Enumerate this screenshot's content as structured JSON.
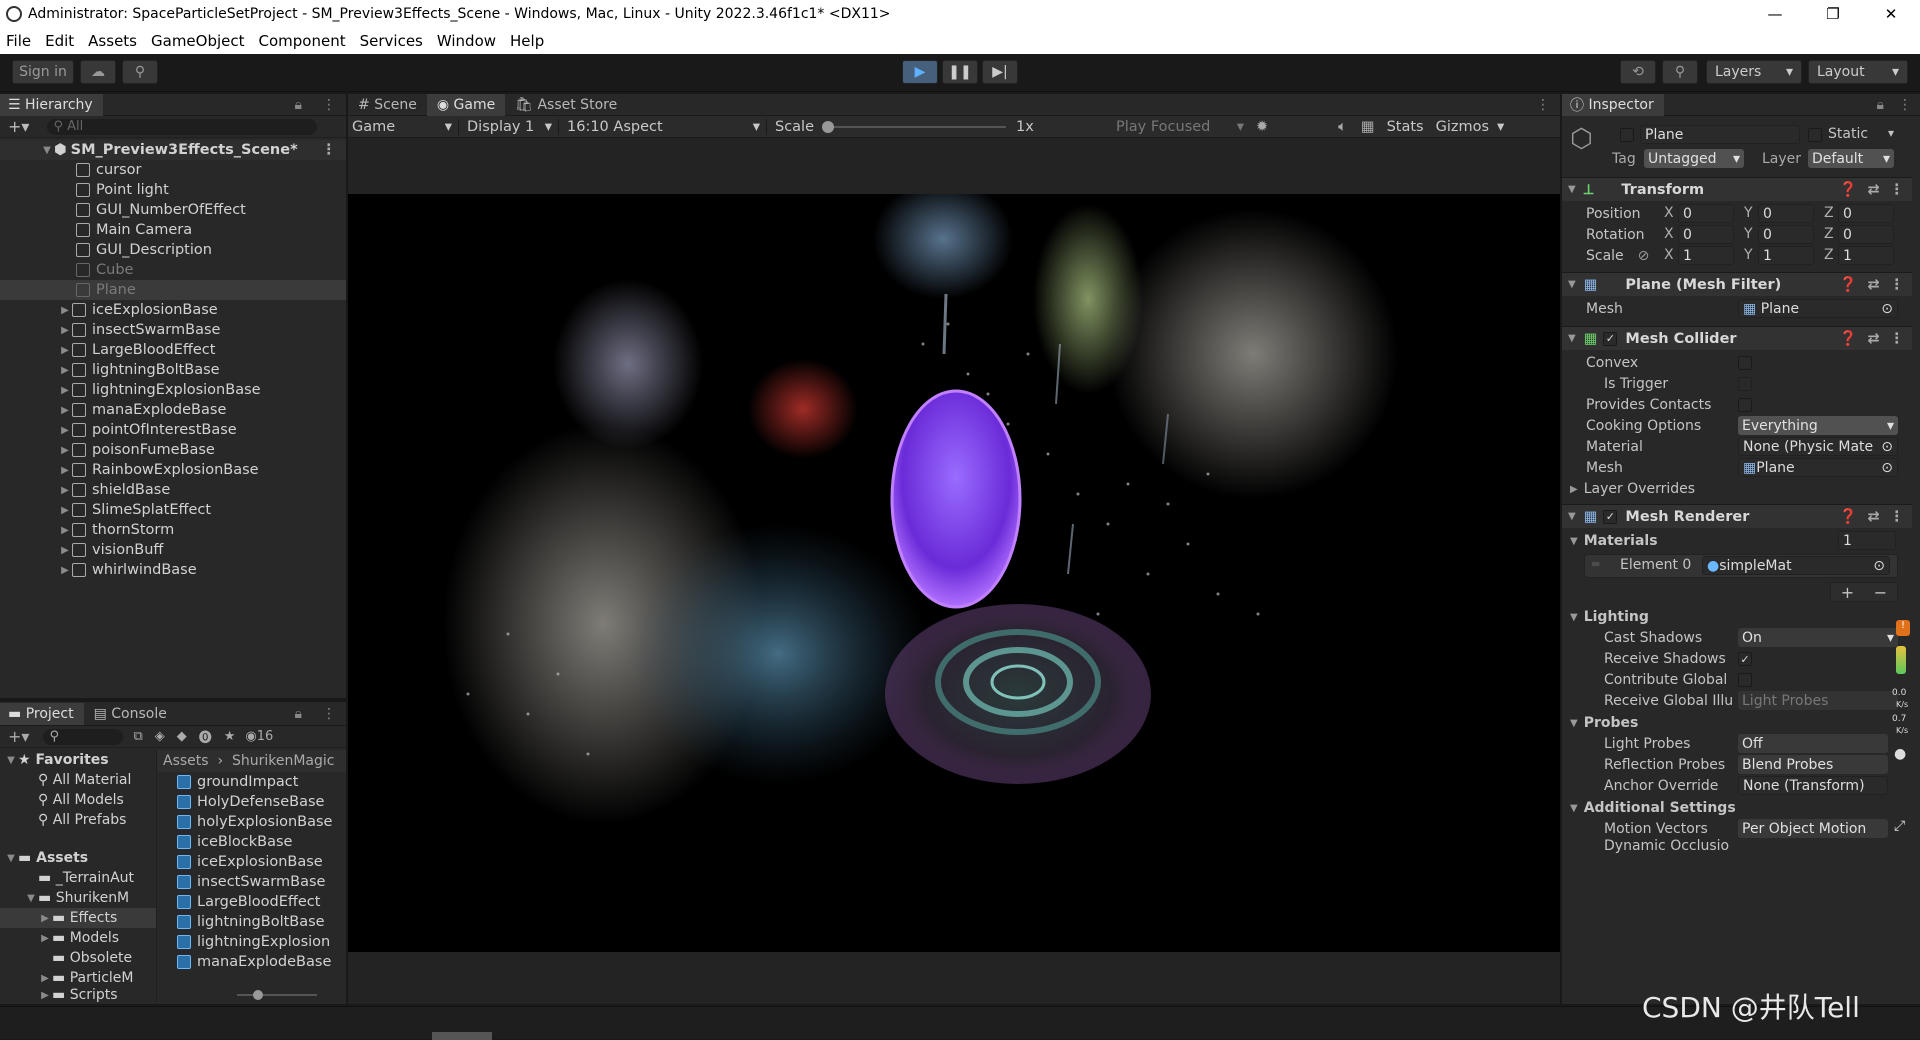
{
  "window": {
    "title": "Administrator: SpaceParticleSetProject - SM_Preview3Effects_Scene - Windows, Mac, Linux - Unity 2022.3.46f1c1* <DX11>"
  },
  "menu": [
    "File",
    "Edit",
    "Assets",
    "GameObject",
    "Component",
    "Services",
    "Window",
    "Help"
  ],
  "toolbar": {
    "sign_in": "Sign in",
    "layers": "Layers",
    "layout": "Layout"
  },
  "hierarchy": {
    "tab": "Hierarchy",
    "search_placeholder": "All",
    "scene": "SM_Preview3Effects_Scene*",
    "items": [
      "cursor",
      "Point light",
      "GUI_NumberOfEffect",
      "Main Camera",
      "GUI_Description",
      "Cube",
      "Plane",
      "iceExplosionBase",
      "insectSwarmBase",
      "LargeBloodEffect",
      "lightningBoltBase",
      "lightningExplosionBase",
      "manaExplodeBase",
      "pointOfInterestBase",
      "poisonFumeBase",
      "RainbowExplosionBase",
      "shieldBase",
      "SlimeSplatEffect",
      "thornStorm",
      "visionBuff",
      "whirlwindBase"
    ]
  },
  "project": {
    "tab_project": "Project",
    "tab_console": "Console",
    "hidden_count": "16",
    "favorites": "Favorites",
    "fav_items": [
      "All Material",
      "All Models",
      "All Prefabs"
    ],
    "assets": "Assets",
    "asset_tree": [
      "_TerrainAut",
      "ShurikenM",
      "Effects",
      "Models",
      "Obsolete",
      "ParticleM",
      "Scripts"
    ],
    "breadcrumb": [
      "Assets",
      "ShurikenMagic"
    ],
    "files": [
      "groundImpact",
      "HolyDefenseBase",
      "holyExplosionBase",
      "iceBlockBase",
      "iceExplosionBase",
      "insectSwarmBase",
      "LargeBloodEffect",
      "lightningBoltBase",
      "lightningExplosion",
      "manaExplodeBase"
    ]
  },
  "game": {
    "tabs": [
      "Scene",
      "Game",
      "Asset Store"
    ],
    "mode": "Game",
    "display": "Display 1",
    "aspect": "16:10 Aspect",
    "scale_label": "Scale",
    "scale_value": "1x",
    "play_focused": "Play Focused",
    "stats": "Stats",
    "gizmos": "Gizmos"
  },
  "inspector": {
    "tab": "Inspector",
    "name": "Plane",
    "static": "Static",
    "tag_label": "Tag",
    "tag": "Untagged",
    "layer_label": "Layer",
    "layer": "Default",
    "transform": {
      "title": "Transform",
      "rows": [
        {
          "label": "Position",
          "x": "0",
          "y": "0",
          "z": "0"
        },
        {
          "label": "Rotation",
          "x": "0",
          "y": "0",
          "z": "0"
        },
        {
          "label": "Scale",
          "x": "1",
          "y": "1",
          "z": "1"
        }
      ]
    },
    "axis": [
      "X",
      "Y",
      "Z"
    ],
    "meshfilter": {
      "title": "Plane (Mesh Filter)",
      "mesh_label": "Mesh",
      "mesh": "Plane"
    },
    "meshcollider": {
      "title": "Mesh Collider",
      "convex": "Convex",
      "is_trigger": "Is Trigger",
      "provides_contacts": "Provides Contacts",
      "cooking_label": "Cooking Options",
      "cooking": "Everything",
      "material_label": "Material",
      "material": "None (Physic Mate",
      "mesh_label": "Mesh",
      "mesh": "Plane",
      "layer_overrides": "Layer Overrides"
    },
    "meshrenderer": {
      "title": "Mesh Renderer",
      "materials": "Materials",
      "materials_count": "1",
      "element0": "Element 0",
      "element0_value": "simpleMat",
      "lighting": "Lighting",
      "cast_shadows_label": "Cast Shadows",
      "cast_shadows": "On",
      "receive_shadows": "Receive Shadows",
      "contribute_global": "Contribute Global",
      "receive_global": "Receive Global Illu",
      "receive_global_value": "Light Probes",
      "probes": "Probes",
      "light_probes_label": "Light Probes",
      "light_probes": "Off",
      "reflection_probes_label": "Reflection Probes",
      "reflection_probes": "Blend Probes",
      "anchor_label": "Anchor Override",
      "anchor": "None (Transform)",
      "additional": "Additional Settings",
      "motion_label": "Motion Vectors",
      "motion": "Per Object Motion",
      "dynamic": "Dynamic Occlusio"
    }
  },
  "overlay": {
    "watermark": "CSDN @井队Tell",
    "net1": "0.0",
    "net1u": "K/s",
    "net2": "0.7",
    "net2u": "K/s"
  }
}
